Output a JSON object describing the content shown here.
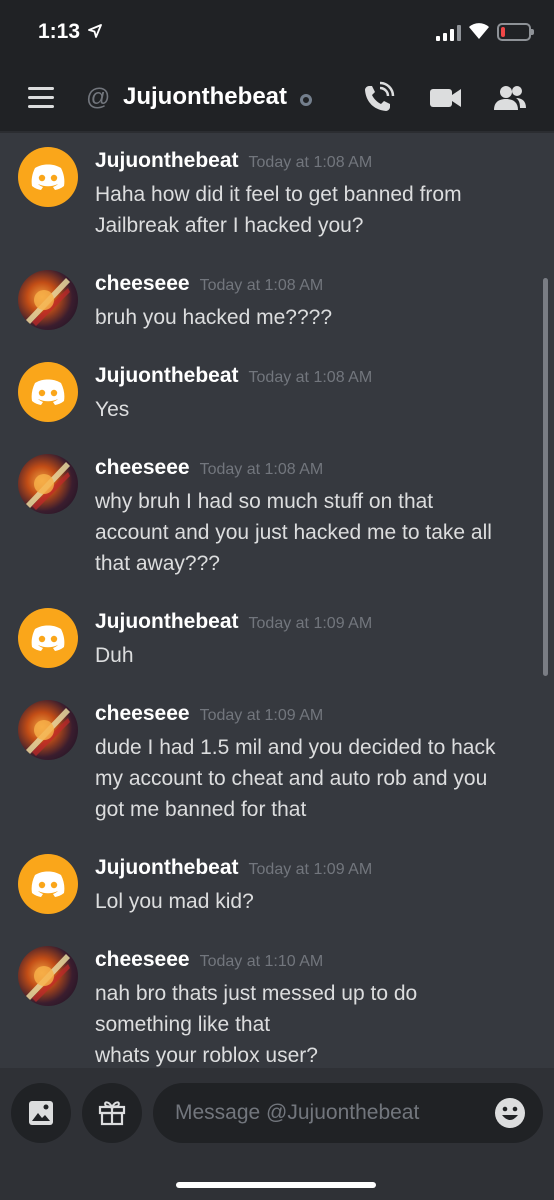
{
  "status_bar": {
    "time": "1:13",
    "icons": [
      "location-arrow-icon",
      "cellular-signal-icon",
      "wifi-icon",
      "battery-icon"
    ],
    "battery_level": 0.15,
    "battery_color": "#f04747"
  },
  "header": {
    "at_symbol": "@",
    "channel_name": "Jujuonthebeat",
    "icons": [
      "menu-icon",
      "call-icon",
      "video-icon",
      "members-icon"
    ]
  },
  "messages": [
    {
      "author": "Jujuonthebeat",
      "avatar": "discord-logo-avatar",
      "timestamp": "Today at 1:08 AM",
      "lines": [
        "Haha how did it feel to get banned from",
        "Jailbreak after I hacked you?"
      ]
    },
    {
      "author": "cheeseee",
      "avatar": "profile-photo-avatar",
      "timestamp": "Today at 1:08 AM",
      "lines": [
        "bruh you hacked me????"
      ]
    },
    {
      "author": "Jujuonthebeat",
      "avatar": "discord-logo-avatar",
      "timestamp": "Today at 1:08 AM",
      "lines": [
        "Yes"
      ]
    },
    {
      "author": "cheeseee",
      "avatar": "profile-photo-avatar",
      "timestamp": "Today at 1:08 AM",
      "lines": [
        "why bruh I had so much stuff on that",
        "account and you just hacked me to take all",
        "that away???"
      ]
    },
    {
      "author": "Jujuonthebeat",
      "avatar": "discord-logo-avatar",
      "timestamp": "Today at 1:09 AM",
      "lines": [
        "Duh"
      ]
    },
    {
      "author": "cheeseee",
      "avatar": "profile-photo-avatar",
      "timestamp": "Today at 1:09 AM",
      "lines": [
        "dude I had 1.5 mil and you decided to hack",
        "my account to cheat and auto rob and you",
        "got me banned for that"
      ]
    },
    {
      "author": "Jujuonthebeat",
      "avatar": "discord-logo-avatar",
      "timestamp": "Today at 1:09 AM",
      "lines": [
        "Lol you mad kid?"
      ]
    },
    {
      "author": "cheeseee",
      "avatar": "profile-photo-avatar",
      "timestamp": "Today at 1:10 AM",
      "lines": [
        "nah bro thats just messed up to do",
        "something like that",
        "whats your roblox user?"
      ]
    }
  ],
  "composer": {
    "placeholder": "Message @Jujuonthebeat",
    "icons": [
      "image-icon",
      "gift-icon",
      "emoji-icon"
    ]
  },
  "colors": {
    "background": "#36393f",
    "header": "#202225",
    "avatar_accent": "#faa61a",
    "name": "#ffffff",
    "timestamp": "#72767d"
  }
}
